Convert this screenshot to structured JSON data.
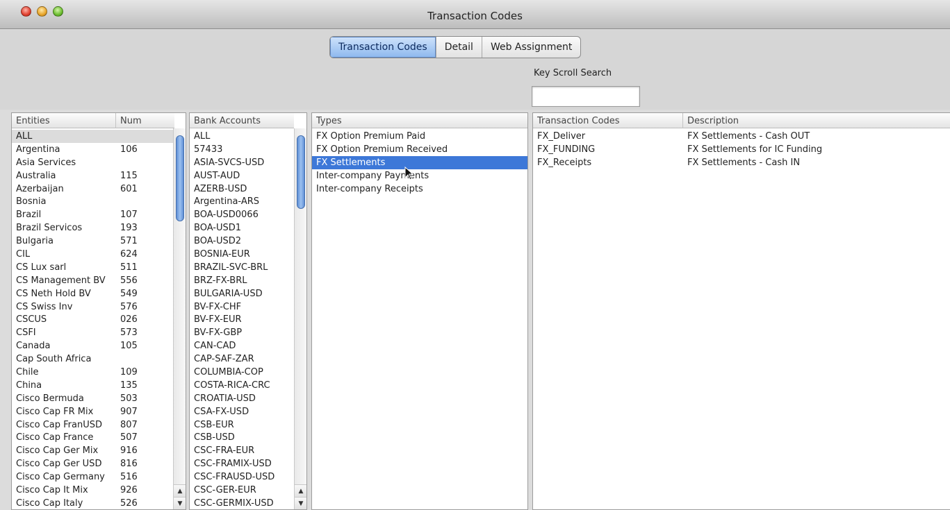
{
  "window": {
    "title": "Transaction Codes"
  },
  "tabs": [
    {
      "label": "Transaction Codes",
      "active": true
    },
    {
      "label": "Detail",
      "active": false
    },
    {
      "label": "Web Assignment",
      "active": false
    }
  ],
  "search": {
    "label": "Key Scroll Search",
    "value": ""
  },
  "entities": {
    "headers": {
      "name": "Entities",
      "num": "Num"
    },
    "rows": [
      {
        "name": "ALL",
        "num": ""
      },
      {
        "name": "Argentina",
        "num": "106"
      },
      {
        "name": "Asia Services",
        "num": ""
      },
      {
        "name": "Australia",
        "num": "115"
      },
      {
        "name": "Azerbaijan",
        "num": "601"
      },
      {
        "name": "Bosnia",
        "num": ""
      },
      {
        "name": "Brazil",
        "num": "107"
      },
      {
        "name": "Brazil Servicos",
        "num": "193"
      },
      {
        "name": "Bulgaria",
        "num": "571"
      },
      {
        "name": "CIL",
        "num": "624"
      },
      {
        "name": "CS Lux sarl",
        "num": "511"
      },
      {
        "name": "CS Management BV",
        "num": "556"
      },
      {
        "name": "CS Neth Hold BV",
        "num": "549"
      },
      {
        "name": "CS Swiss Inv",
        "num": "576"
      },
      {
        "name": "CSCUS",
        "num": "026"
      },
      {
        "name": "CSFI",
        "num": "573"
      },
      {
        "name": "Canada",
        "num": "105"
      },
      {
        "name": "Cap South Africa",
        "num": ""
      },
      {
        "name": "Chile",
        "num": "109"
      },
      {
        "name": "China",
        "num": "135"
      },
      {
        "name": "Cisco Bermuda",
        "num": "503"
      },
      {
        "name": "Cisco Cap FR Mix",
        "num": "907"
      },
      {
        "name": "Cisco Cap FranUSD",
        "num": "807"
      },
      {
        "name": "Cisco Cap France",
        "num": "507"
      },
      {
        "name": "Cisco Cap Ger Mix",
        "num": "916"
      },
      {
        "name": "Cisco Cap Ger USD",
        "num": "816"
      },
      {
        "name": "Cisco Cap Germany",
        "num": "516"
      },
      {
        "name": "Cisco Cap It Mix",
        "num": "926"
      },
      {
        "name": "Cisco Cap Italy",
        "num": "526"
      }
    ]
  },
  "bank_accounts": {
    "header": "Bank Accounts",
    "rows": [
      "ALL",
      "57433",
      "ASIA-SVCS-USD",
      "AUST-AUD",
      "AZERB-USD",
      "Argentina-ARS",
      "BOA-USD0066",
      "BOA-USD1",
      "BOA-USD2",
      "BOSNIA-EUR",
      "BRAZIL-SVC-BRL",
      "BRZ-FX-BRL",
      "BULGARIA-USD",
      "BV-FX-CHF",
      "BV-FX-EUR",
      "BV-FX-GBP",
      "CAN-CAD",
      "CAP-SAF-ZAR",
      "COLUMBIA-COP",
      "COSTA-RICA-CRC",
      "CROATIA-USD",
      "CSA-FX-USD",
      "CSB-EUR",
      "CSB-USD",
      "CSC-FRA-EUR",
      "CSC-FRAMIX-USD",
      "CSC-FRAUSD-USD",
      "CSC-GER-EUR",
      "CSC-GERMIX-USD"
    ]
  },
  "types": {
    "header": "Types",
    "rows": [
      "FX Option Premium Paid",
      "FX Option Premium Received",
      "FX Settlements",
      "Inter-company Payments",
      "Inter-company Receipts"
    ],
    "selected": "FX Settlements"
  },
  "transaction_codes": {
    "headers": {
      "code": "Transaction Codes",
      "description": "Description"
    },
    "rows": [
      {
        "code": "FX_Deliver",
        "description": "FX Settlements - Cash OUT"
      },
      {
        "code": "FX_FUNDING",
        "description": "FX Settlements for IC Funding"
      },
      {
        "code": "FX_Receipts",
        "description": "FX Settlements - Cash IN"
      }
    ]
  },
  "icons": {
    "close": "close-button-red",
    "minimize": "minimize-button-yellow",
    "zoom": "zoom-button-green",
    "scroll_up": "up-arrow-icon",
    "scroll_down": "down-arrow-icon",
    "cursor": "mouse-pointer-icon"
  },
  "colors": {
    "selection": "#3d78d8",
    "tab_active": "#8db8ee",
    "scroll_thumb": "#5f8fd6"
  }
}
